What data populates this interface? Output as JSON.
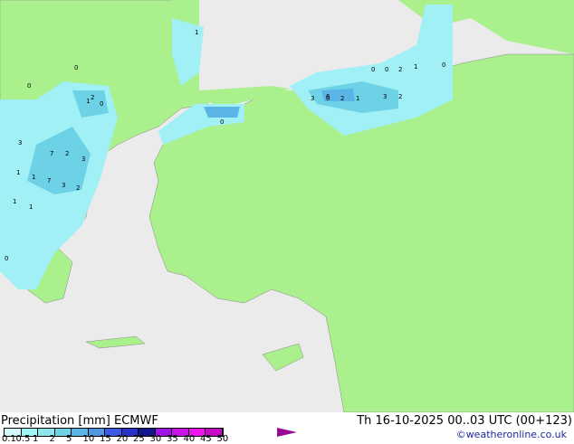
{
  "title": "Precipitation [mm]",
  "model": "ECMWF",
  "valid_time": "Th 16-10-2025 00..03 UTC (00+123)",
  "credit": "©weatheronline.co.uk",
  "legend": {
    "ticks": [
      "0.1",
      "0.5",
      "1",
      "2",
      "5",
      "10",
      "15",
      "20",
      "25",
      "30",
      "35",
      "40",
      "45",
      "50"
    ],
    "colors": [
      "#d2fafa",
      "#a0f5f5",
      "#8ce6eb",
      "#6ed2e6",
      "#5ab4e6",
      "#5096e1",
      "#3c5ae6",
      "#2832c8",
      "#14148c",
      "#a014e6",
      "#c814e6",
      "#f014f0",
      "#c80ac8",
      "#960a96"
    ]
  },
  "colors": {
    "land": "#aaf08c",
    "sea": "#ebebeb",
    "rain_light": "#a0f0f5",
    "rain_mid": "#6ed2e6",
    "rain_heavy": "#5ab4e6"
  },
  "point_values": [
    "1",
    "0",
    "0",
    "2",
    "1",
    "0",
    "3",
    "0",
    "2",
    "1",
    "6",
    "2",
    "3",
    "1",
    "0",
    "2",
    "0",
    "7",
    "2",
    "3",
    "1",
    "7",
    "3",
    "2",
    "1",
    "1",
    "1",
    "0",
    "3",
    "0",
    "0"
  ]
}
